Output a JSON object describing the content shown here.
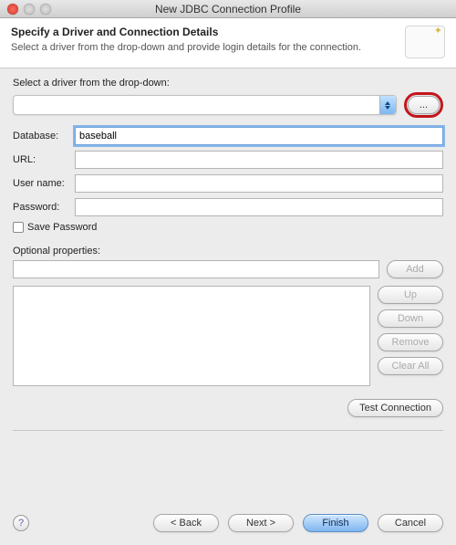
{
  "window": {
    "title": "New JDBC Connection Profile"
  },
  "header": {
    "heading": "Specify a Driver and Connection Details",
    "sub": "Select a driver from the drop-down and provide login details for the connection."
  },
  "driver": {
    "select_label": "Select a driver from the drop-down:",
    "selected": "",
    "browse_label": "..."
  },
  "form": {
    "database_label": "Database:",
    "database_value": "baseball",
    "url_label": "URL:",
    "url_value": "",
    "user_label": "User name:",
    "user_value": "",
    "password_label": "Password:",
    "password_value": "",
    "save_pw_label": "Save Password"
  },
  "optional": {
    "label": "Optional properties:",
    "new_value": "",
    "add": "Add",
    "up": "Up",
    "down": "Down",
    "remove": "Remove",
    "clear": "Clear All"
  },
  "test": {
    "label": "Test Connection"
  },
  "footer": {
    "back": "< Back",
    "next": "Next >",
    "finish": "Finish",
    "cancel": "Cancel"
  }
}
